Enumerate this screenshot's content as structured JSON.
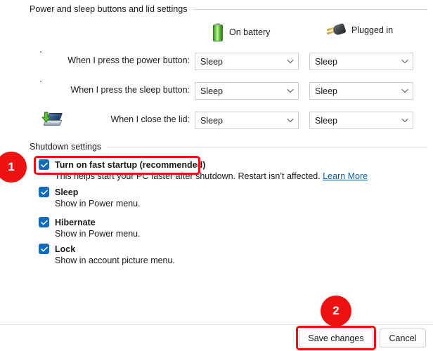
{
  "sections": {
    "power_lid": {
      "title": "Power and sleep buttons and lid settings"
    },
    "shutdown": {
      "title": "Shutdown settings"
    }
  },
  "columns": [
    {
      "label": "On battery",
      "icon": "battery-icon"
    },
    {
      "label": "Plugged in",
      "icon": "power-plug-icon"
    }
  ],
  "rows": [
    {
      "label": "When I press the power button:",
      "icon": "power-button-icon",
      "on_battery": "Sleep",
      "plugged_in": "Sleep"
    },
    {
      "label": "When I press the sleep button:",
      "icon": "sleep-moon-icon",
      "on_battery": "Sleep",
      "plugged_in": "Sleep"
    },
    {
      "label": "When I close the lid:",
      "icon": "laptop-lid-icon",
      "on_battery": "Sleep",
      "plugged_in": "Sleep"
    }
  ],
  "shutdown_options": [
    {
      "label": "Turn on fast startup (recommended)",
      "checked": true,
      "description": "This helps start your PC faster after shutdown. Restart isn’t affected.",
      "link": "Learn More"
    },
    {
      "label": "Sleep",
      "checked": true,
      "description": "Show in Power menu.",
      "link": ""
    },
    {
      "label": "Hibernate",
      "checked": true,
      "description": "Show in Power menu.",
      "link": ""
    },
    {
      "label": "Lock",
      "checked": true,
      "description": "Show in account picture menu.",
      "link": ""
    }
  ],
  "footer": {
    "save_label": "Save changes",
    "cancel_label": "Cancel"
  },
  "annotations": {
    "badge1": "1",
    "badge2": "2",
    "color": "#ee1111"
  },
  "colors": {
    "checkbox_blue": "#0f6cbd",
    "link_blue": "#0b5fae",
    "battery_green": "#63bb3d"
  }
}
